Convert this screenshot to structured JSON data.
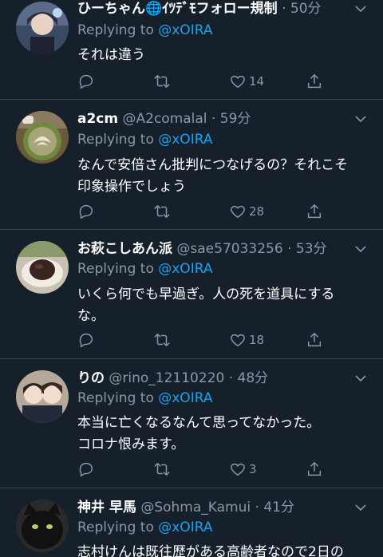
{
  "colors": {
    "background": "#15202b",
    "divider": "#38444d",
    "secondary_text": "#8899a6",
    "mention": "#1da1f2"
  },
  "tweets": [
    {
      "name": "ひーちゃん🌐ｲﾂﾃﾞﾓフォロー規制",
      "handle": "",
      "dot": "·",
      "time": "50分",
      "replying_prefix": "Replying to",
      "replying_to": "@xOIRA",
      "text": "それは違う",
      "likes": "14"
    },
    {
      "name": "a2cm",
      "handle": "@A2comalal",
      "dot": "·",
      "time": "59分",
      "replying_prefix": "Replying to",
      "replying_to": "@xOIRA",
      "text": "なんで安倍さん批判につなげるの？それこそ\n印象操作でしょう",
      "likes": "28"
    },
    {
      "name": "お萩こしあん派",
      "handle": "@sae57033256",
      "dot": "·",
      "time": "53分",
      "replying_prefix": "Replying to",
      "replying_to": "@xOIRA",
      "text": "いくら何でも早過ぎ。人の死を道具にする\nな。",
      "likes": "18"
    },
    {
      "name": "りの",
      "handle": "@rino_12110220",
      "dot": "·",
      "time": "48分",
      "replying_prefix": "Replying to",
      "replying_to": "@xOIRA",
      "text": "本当に亡くなるなんて思ってなかった。\nコロナ恨みます。",
      "likes": "3"
    },
    {
      "name": "神井 早馬",
      "handle": "@Sohma_Kamui",
      "dot": "·",
      "time": "41分",
      "replying_prefix": "Replying to",
      "replying_to": "@xOIRA",
      "text": "志村けんは既往歴がある高齢者なので2日の",
      "likes": ""
    }
  ]
}
